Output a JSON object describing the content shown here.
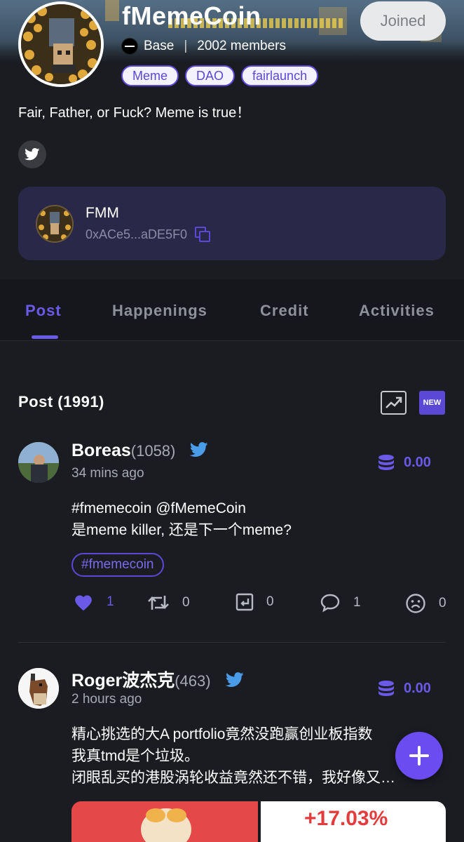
{
  "community": {
    "title": "fMemeCoin",
    "joined_label": "Joined",
    "chain": "Base",
    "members": "2002 members",
    "tags": [
      "Meme",
      "DAO",
      "fairlaunch"
    ],
    "description": "Fair, Father, or Fuck?  Meme is true！",
    "token": {
      "name": "FMM",
      "address": "0xACe5...aDE5F0"
    }
  },
  "tabs": [
    "Post",
    "Happenings",
    "Credit",
    "Activities"
  ],
  "active_tab": "Post",
  "posts_section": {
    "title": "Post (1991)",
    "new_label": "NEW"
  },
  "posts": [
    {
      "user": "Boreas",
      "count": "(1058)",
      "time": "34 mins ago",
      "credit": "0.00",
      "text_lines": [
        "#fmemecoin @fMemeCoin",
        "是meme killer, 还是下一个meme?"
      ],
      "hashtag": "#fmemecoin",
      "likes": "1",
      "retweets": "0",
      "quotes": "0",
      "comments": "1",
      "dislikes": "0"
    },
    {
      "user": "Roger波杰克",
      "count": "(463)",
      "time": "2 hours ago",
      "credit": "0.00",
      "text_lines": [
        "精心挑选的大A portfolio竟然没跑赢创业板指数",
        "我真tmd是个垃圾。",
        "闭眼乱买的港股涡轮收益竟然还不错，我好像又…"
      ],
      "image_text": "+17.03%"
    }
  ],
  "colors": {
    "accent": "#6b59e8",
    "background": "#1b1c22",
    "card": "#2a2848",
    "twitter": "#4a9be8"
  }
}
